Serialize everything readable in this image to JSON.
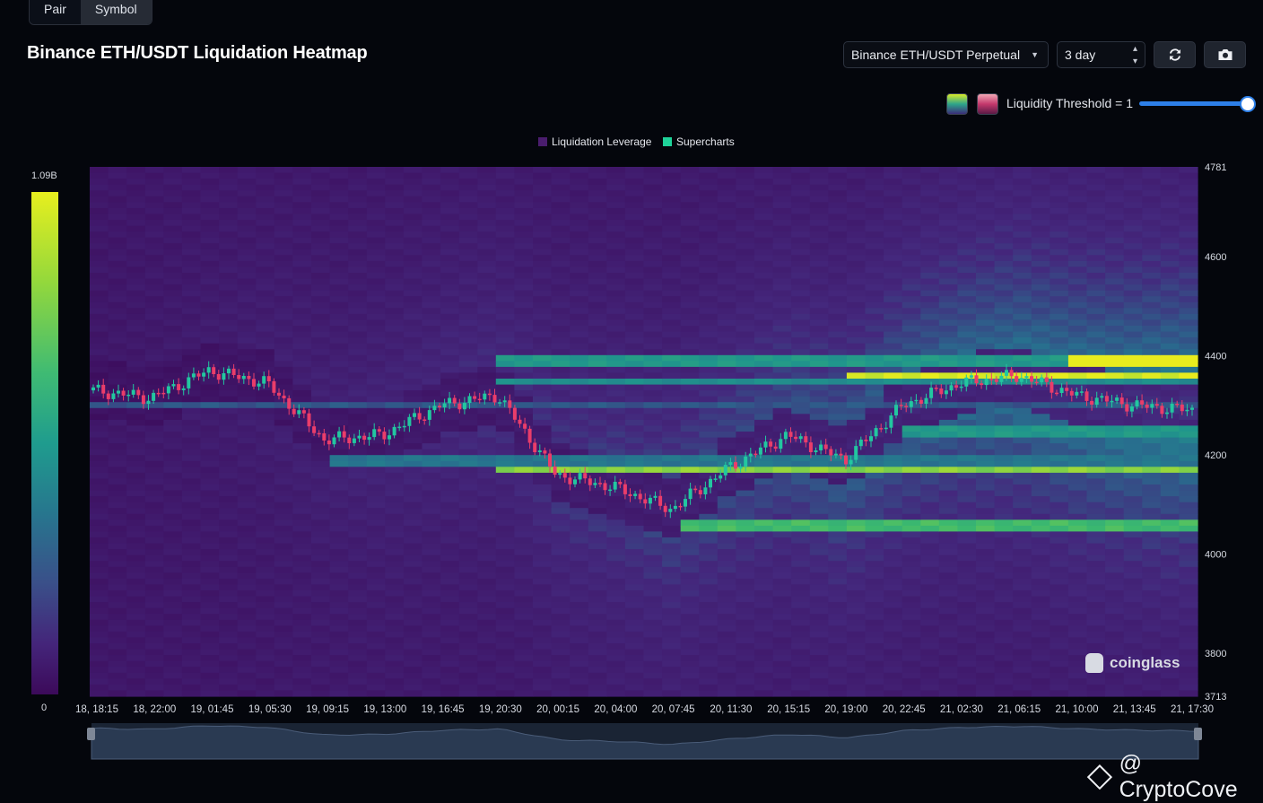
{
  "tabs": [
    {
      "label": "Pair"
    },
    {
      "label": "Symbol"
    }
  ],
  "title": "Binance ETH/USDT Liquidation Heatmap",
  "controls": {
    "market_select": "Binance ETH/USDT Perpetual",
    "range_select": "3 day",
    "refresh_icon": "refresh-icon",
    "camera_icon": "camera-icon",
    "threshold_label": "Liquidity Threshold = 1",
    "threshold_value": 1.0
  },
  "legend": [
    {
      "label": "Liquidation Leverage",
      "color": "#4a1d6e"
    },
    {
      "label": "Supercharts",
      "color": "#1fd39a"
    }
  ],
  "colorbar": {
    "max_label": "1.09B",
    "min_label": "0",
    "colors": [
      "#e7ef1e",
      "#3fbb73",
      "#27768e",
      "#44257a",
      "#3c0a5a"
    ]
  },
  "watermark": "coinglass",
  "credit": "@ CryptoCove",
  "chart_data": {
    "type": "heatmap",
    "title": "Binance ETH/USDT Liquidation Heatmap",
    "x_ticks": [
      "18, 18:15",
      "18, 22:00",
      "19, 01:45",
      "19, 05:30",
      "19, 09:15",
      "19, 13:00",
      "19, 16:45",
      "19, 20:30",
      "20, 00:15",
      "20, 04:00",
      "20, 07:45",
      "20, 11:30",
      "20, 15:15",
      "20, 19:00",
      "20, 22:45",
      "21, 02:30",
      "21, 06:15",
      "21, 10:00",
      "21, 13:45",
      "21, 17:30"
    ],
    "y_ticks": [
      4781,
      4600,
      4400,
      4200,
      4000,
      3800,
      3713
    ],
    "ylim": [
      3713,
      4781
    ],
    "value_range": [
      0,
      1090000000
    ],
    "liquidity_bands": [
      {
        "price": 4391,
        "start_index": 17,
        "intensity": 1.0
      },
      {
        "price": 4391,
        "start_index": 7,
        "intensity": 0.6
      },
      {
        "price": 4360,
        "start_index": 13,
        "intensity": 0.95
      },
      {
        "price": 4350,
        "start_index": 7,
        "intensity": 0.55
      },
      {
        "price": 4245,
        "start_index": 14,
        "intensity": 0.6
      },
      {
        "price": 4170,
        "start_index": 7,
        "intensity": 0.85
      },
      {
        "price": 4190,
        "start_index": 4,
        "intensity": 0.45
      },
      {
        "price": 4058,
        "start_index": 10,
        "intensity": 0.75
      },
      {
        "price": 4300,
        "start_index": 0,
        "intensity": 0.35
      }
    ],
    "price_series": {
      "name": "Supercharts",
      "x": [
        "18, 18:15",
        "18, 22:00",
        "19, 01:45",
        "19, 05:30",
        "19, 09:15",
        "19, 13:00",
        "19, 16:45",
        "19, 20:30",
        "20, 00:15",
        "20, 04:00",
        "20, 07:45",
        "20, 11:30",
        "20, 15:15",
        "20, 19:00",
        "20, 22:45",
        "21, 02:30",
        "21, 06:15",
        "21, 10:00",
        "21, 13:45",
        "21, 17:30"
      ],
      "close": [
        4330,
        4315,
        4370,
        4345,
        4230,
        4240,
        4300,
        4320,
        4160,
        4135,
        4090,
        4175,
        4240,
        4190,
        4300,
        4345,
        4360,
        4320,
        4300,
        4290
      ]
    }
  }
}
